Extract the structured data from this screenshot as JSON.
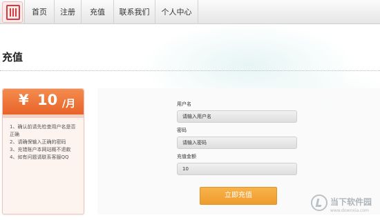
{
  "nav": {
    "items": [
      "首页",
      "注册",
      "充值",
      "联系我们",
      "个人中心"
    ]
  },
  "page": {
    "title": "充值"
  },
  "price_card": {
    "currency": "¥",
    "amount": "10",
    "unit": "/月",
    "notes": [
      "1、确认前请先检查用户名是否",
      "正确",
      "2、请确保输入正确的密码",
      "3、充错账户本网站概不退款",
      "4、如有问题请联系客服QQ"
    ]
  },
  "form": {
    "username_label": "用户名",
    "username_value": "请输入用户名",
    "password_label": "密码",
    "password_value": "请输入密码",
    "amount_label": "充值金额",
    "amount_value": "10",
    "submit_label": "立即充值"
  },
  "watermark": {
    "name": "当下软件园",
    "url": "www.downxia.com"
  },
  "colors": {
    "accent_orange": "#ef9c2e",
    "card_header": "#e8642a"
  }
}
